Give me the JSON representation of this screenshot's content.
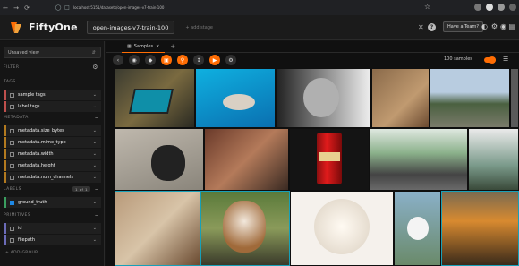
{
  "browser": {
    "url": "localhost:5151/datasets/open-images-v7-train-100"
  },
  "app": {
    "brand": "FiftyOne",
    "dataset_name": "open-images-v7-train-100",
    "add_stage_placeholder": "+ add stage",
    "teams_button": "Have a Team?",
    "help_glyph": "?"
  },
  "sidebar": {
    "view_selector": "Unsaved view",
    "filter_label": "FILTER",
    "sections": {
      "tags": "TAGS",
      "metadata": "METADATA",
      "labels": "LABELS",
      "primitives": "PRIMITIVES"
    },
    "tag_rows": [
      "sample tags",
      "label tags"
    ],
    "metadata_rows": [
      "metadata.size_bytes",
      "metadata.mime_type",
      "metadata.width",
      "metadata.height",
      "metadata.num_channels"
    ],
    "labels_count": "1 of 1",
    "label_rows": [
      "ground_truth"
    ],
    "primitive_rows": [
      "id",
      "filepath"
    ],
    "add_group": "+ ADD GROUP"
  },
  "main": {
    "tab_label": "Samples",
    "sample_count": "100 samples"
  },
  "icons": {
    "accent": "#ff6d04",
    "selected_border": "#18a0b8",
    "tag_color": "#c0504d",
    "metadata_color": "#b37a1f",
    "labels_color": "#3a9e5f"
  }
}
